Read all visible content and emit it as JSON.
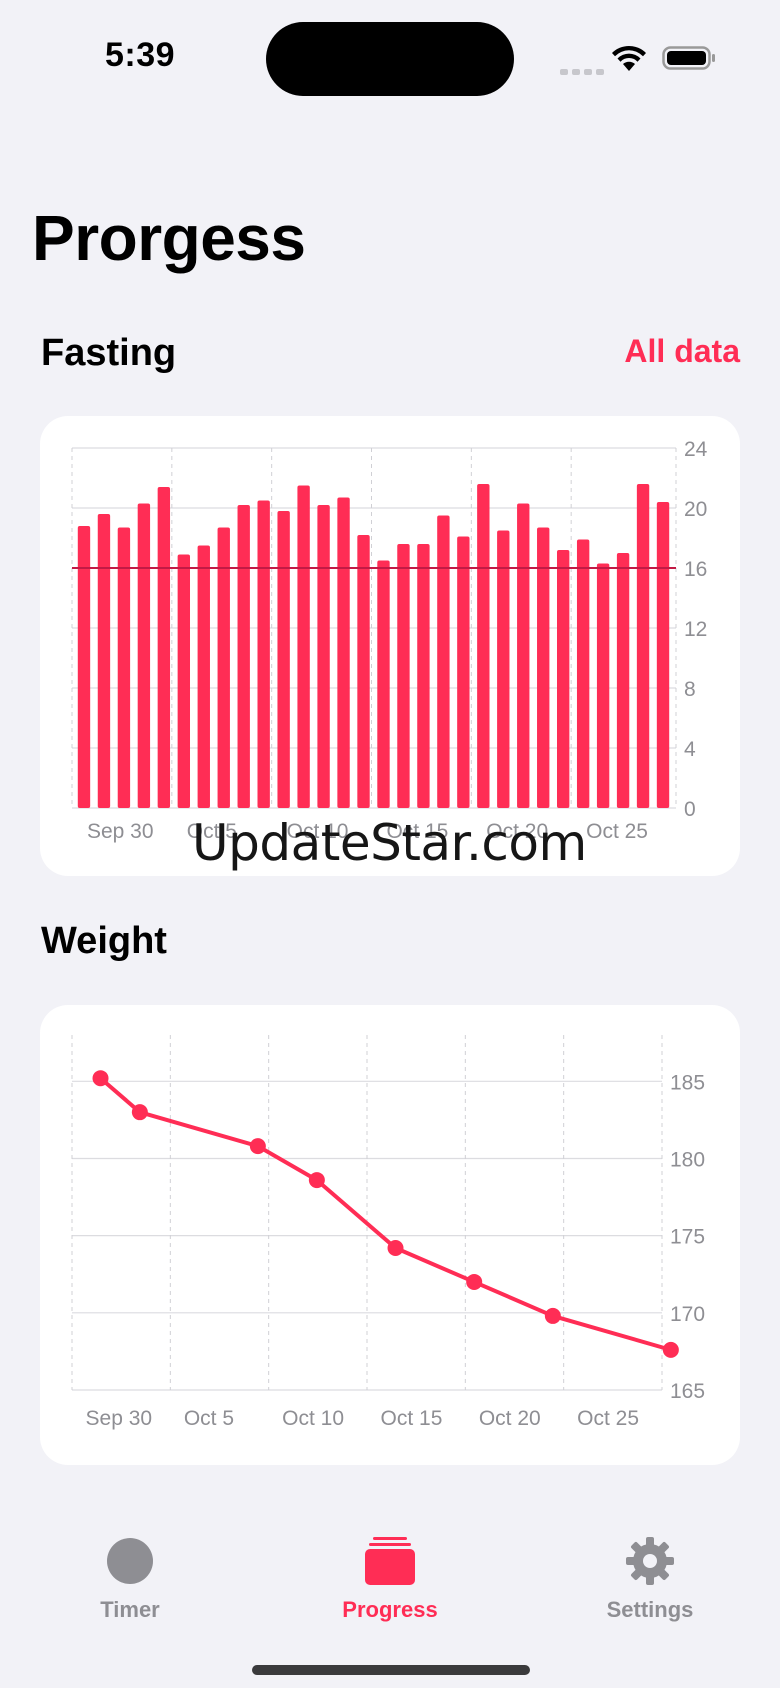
{
  "status": {
    "time": "5:39"
  },
  "page": {
    "title": "Prorgess"
  },
  "fasting": {
    "title": "Fasting",
    "all_data_label": "All data",
    "chart_data": {
      "type": "bar",
      "title": "",
      "xlabel": "",
      "ylabel": "",
      "x_ticks": [
        "Sep 30",
        "Oct 5",
        "Oct 10",
        "Oct 15",
        "Oct 20",
        "Oct 25"
      ],
      "ylim": [
        0,
        24
      ],
      "y_ticks": [
        0,
        4,
        8,
        12,
        16,
        20,
        24
      ],
      "goal_line": 16,
      "start_date": "Sep 29",
      "values": [
        18.8,
        19.6,
        18.7,
        20.3,
        21.4,
        16.9,
        17.5,
        18.7,
        20.2,
        20.5,
        19.8,
        21.5,
        20.2,
        20.7,
        18.2,
        16.5,
        17.6,
        17.6,
        19.5,
        18.1,
        21.6,
        18.5,
        20.3,
        18.7,
        17.2,
        17.9,
        16.3,
        17.0,
        21.6,
        20.4
      ],
      "grid": true,
      "y_axis_position": "right"
    }
  },
  "weight": {
    "title": "Weight",
    "chart_data": {
      "type": "line",
      "title": "",
      "xlabel": "",
      "ylabel": "",
      "x_ticks": [
        "Sep 30",
        "Oct 5",
        "Oct 10",
        "Oct 15",
        "Oct 20",
        "Oct 25"
      ],
      "ylim": [
        165,
        188
      ],
      "y_ticks": [
        165,
        170,
        175,
        180,
        185
      ],
      "points": [
        {
          "x": "Sep 30",
          "y": 185.2
        },
        {
          "x": "Oct 2",
          "y": 183.0
        },
        {
          "x": "Oct 8",
          "y": 180.8
        },
        {
          "x": "Oct 11",
          "y": 178.6
        },
        {
          "x": "Oct 15",
          "y": 174.2
        },
        {
          "x": "Oct 19",
          "y": 172.0
        },
        {
          "x": "Oct 23",
          "y": 169.8
        },
        {
          "x": "Oct 29",
          "y": 167.6
        }
      ],
      "grid": true,
      "y_axis_position": "right"
    }
  },
  "watermark": "UpdateStar.com",
  "tabs": [
    {
      "label": "Timer",
      "icon": "circle-icon",
      "active": false
    },
    {
      "label": "Progress",
      "icon": "stack-icon",
      "active": true
    },
    {
      "label": "Settings",
      "icon": "gear-icon",
      "active": false
    }
  ],
  "colors": {
    "accent": "#ff2d55",
    "inactive": "#8e8e93",
    "background": "#f2f2f7",
    "card": "#ffffff",
    "axis_text": "#8e8e93"
  }
}
